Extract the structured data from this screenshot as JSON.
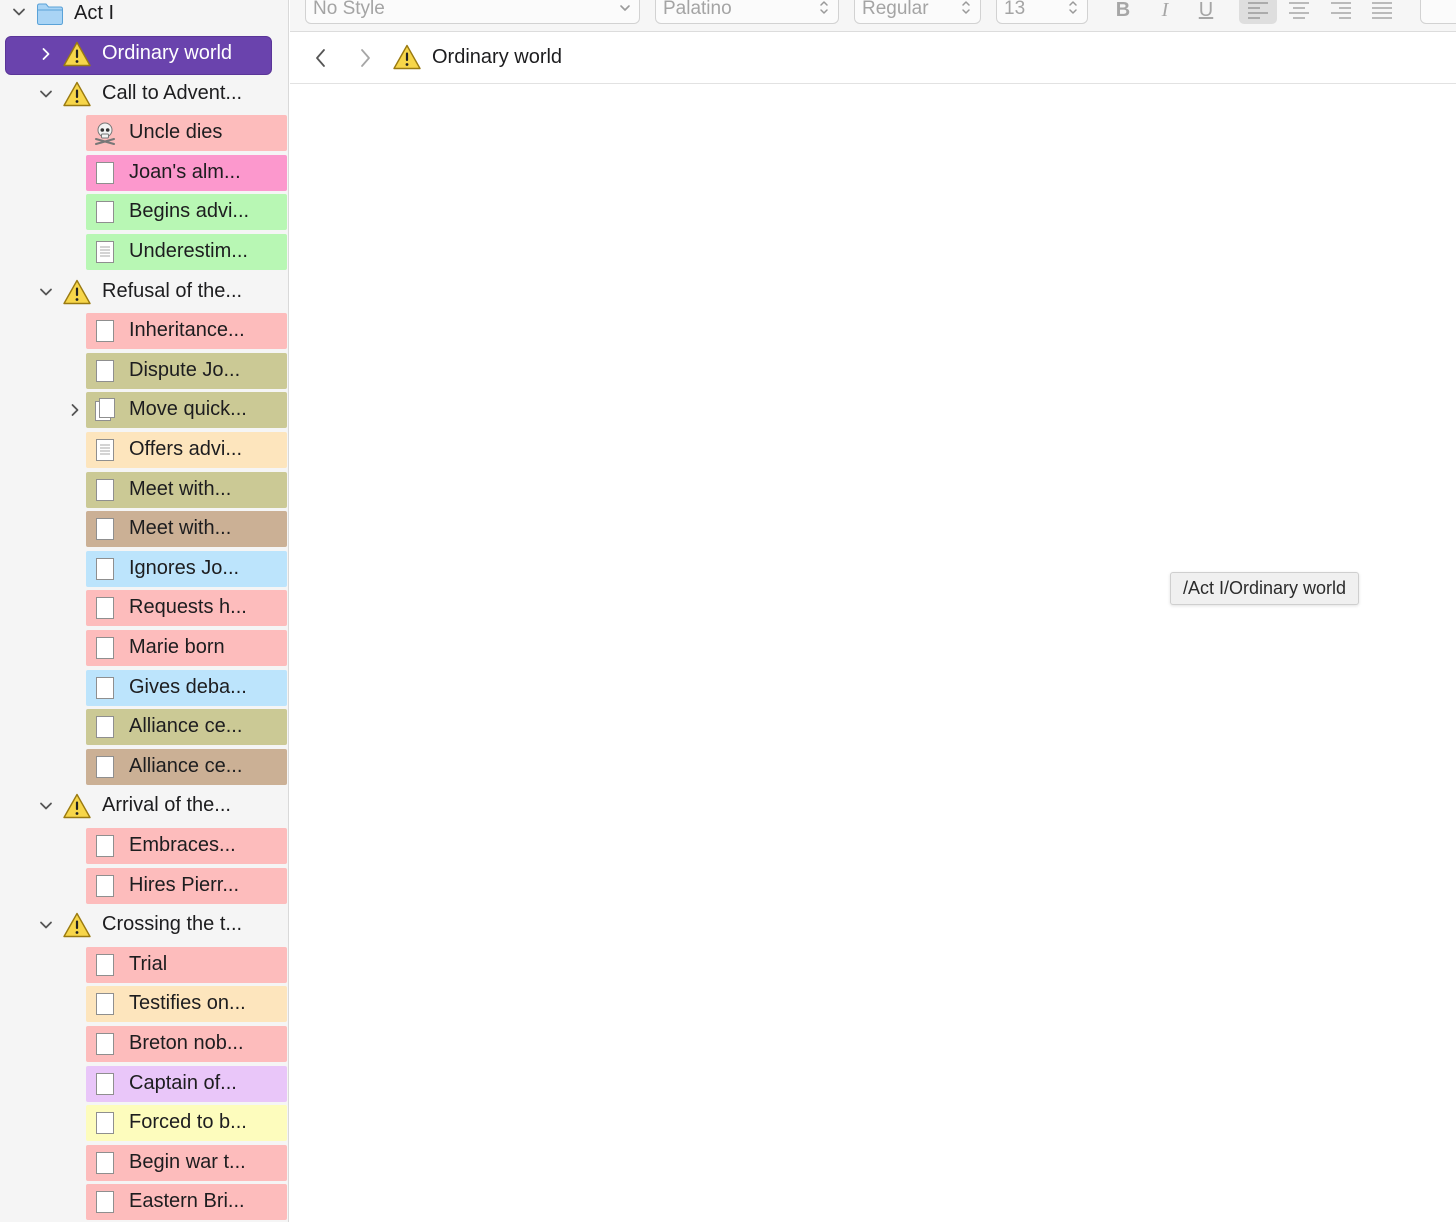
{
  "format_bar": {
    "style": "No Style",
    "font": "Palatino",
    "weight": "Regular",
    "size": "13",
    "bold": "B",
    "italic": "I",
    "underline": "U"
  },
  "editor": {
    "title": "Ordinary world",
    "tooltip": "/Act I/Ordinary world"
  },
  "binder": {
    "root": "Act I",
    "rows": [
      {
        "kind": "chapter",
        "label": "Ordinary world",
        "selected": true,
        "expanded": false
      },
      {
        "kind": "chapter",
        "label": "Call to Advent...",
        "expanded": true
      },
      {
        "kind": "doc",
        "label": "Uncle dies",
        "color": "#fdbcbc",
        "icon": "skull-icon"
      },
      {
        "kind": "doc",
        "label": "Joan's alm...",
        "color": "#fc98cd",
        "icon": "blank-page-icon"
      },
      {
        "kind": "doc",
        "label": "Begins advi...",
        "color": "#b8f7b4",
        "icon": "blank-page-icon"
      },
      {
        "kind": "doc",
        "label": "Underestim...",
        "color": "#b8f7b4",
        "icon": "text-page-icon"
      },
      {
        "kind": "chapter",
        "label": "Refusal of the...",
        "expanded": true
      },
      {
        "kind": "doc",
        "label": "Inheritance...",
        "color": "#fdbcbc",
        "icon": "blank-page-icon"
      },
      {
        "kind": "doc",
        "label": "Dispute Jo...",
        "color": "#cbc995",
        "icon": "blank-page-icon"
      },
      {
        "kind": "doc",
        "label": "Move quick...",
        "color": "#cbc995",
        "icon": "stacked-pages-icon",
        "has_children": true
      },
      {
        "kind": "doc",
        "label": "Offers advi...",
        "color": "#fde5bd",
        "icon": "text-page-icon"
      },
      {
        "kind": "doc",
        "label": "Meet with...",
        "color": "#cbc995",
        "icon": "blank-page-icon"
      },
      {
        "kind": "doc",
        "label": "Meet with...",
        "color": "#cbb095",
        "icon": "blank-page-icon"
      },
      {
        "kind": "doc",
        "label": "Ignores Jo...",
        "color": "#bce4fc",
        "icon": "blank-page-icon"
      },
      {
        "kind": "doc",
        "label": "Requests h...",
        "color": "#fdbcbc",
        "icon": "blank-page-icon"
      },
      {
        "kind": "doc",
        "label": "Marie born",
        "color": "#fdbcbc",
        "icon": "blank-page-icon"
      },
      {
        "kind": "doc",
        "label": "Gives deba...",
        "color": "#bce4fc",
        "icon": "blank-page-icon"
      },
      {
        "kind": "doc",
        "label": "Alliance ce...",
        "color": "#cbc995",
        "icon": "blank-page-icon"
      },
      {
        "kind": "doc",
        "label": "Alliance ce...",
        "color": "#cbb095",
        "icon": "blank-page-icon"
      },
      {
        "kind": "chapter",
        "label": "Arrival of the...",
        "expanded": true
      },
      {
        "kind": "doc",
        "label": "Embraces...",
        "color": "#fdbcbc",
        "icon": "blank-page-icon"
      },
      {
        "kind": "doc",
        "label": "Hires Pierr...",
        "color": "#fdbcbc",
        "icon": "blank-page-icon"
      },
      {
        "kind": "chapter",
        "label": "Crossing the t...",
        "expanded": true
      },
      {
        "kind": "doc",
        "label": "Trial",
        "color": "#fdbcbc",
        "icon": "blank-page-icon"
      },
      {
        "kind": "doc",
        "label": "Testifies on...",
        "color": "#fde5bd",
        "icon": "blank-page-icon"
      },
      {
        "kind": "doc",
        "label": "Breton nob...",
        "color": "#fdbcbc",
        "icon": "blank-page-icon"
      },
      {
        "kind": "doc",
        "label": "Captain of...",
        "color": "#e9c6f9",
        "icon": "blank-page-icon"
      },
      {
        "kind": "doc",
        "label": "Forced to b...",
        "color": "#fdfcbd",
        "icon": "blank-page-icon"
      },
      {
        "kind": "doc",
        "label": "Begin war t...",
        "color": "#fdbcbc",
        "icon": "blank-page-icon"
      },
      {
        "kind": "doc",
        "label": "Eastern Bri...",
        "color": "#fdbcbc",
        "icon": "blank-page-icon"
      }
    ]
  }
}
